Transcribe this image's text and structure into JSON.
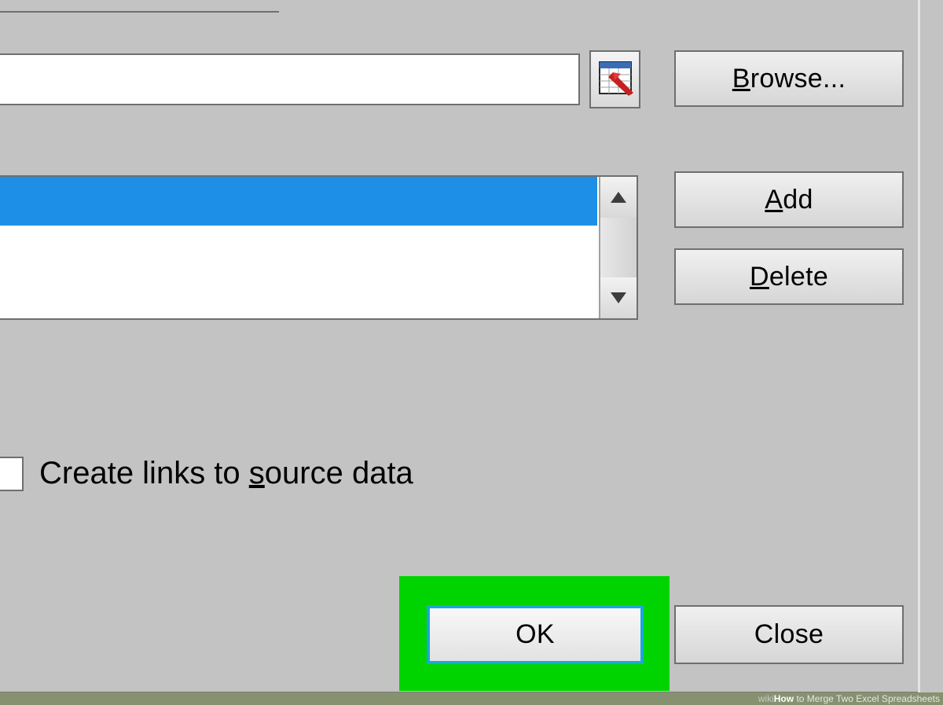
{
  "buttons": {
    "browse_pre": "B",
    "browse_rest": "rowse...",
    "add_pre": "A",
    "add_rest": "dd",
    "delete_pre": "D",
    "delete_rest": "elete",
    "ok": "OK",
    "close": "Close"
  },
  "checkbox": {
    "label_pre": "Create links to ",
    "label_ul": "s",
    "label_post": "ource data"
  },
  "footer": {
    "prefix": "wiki",
    "bold": "How",
    "rest": " to Merge Two Excel Spreadsheets"
  }
}
